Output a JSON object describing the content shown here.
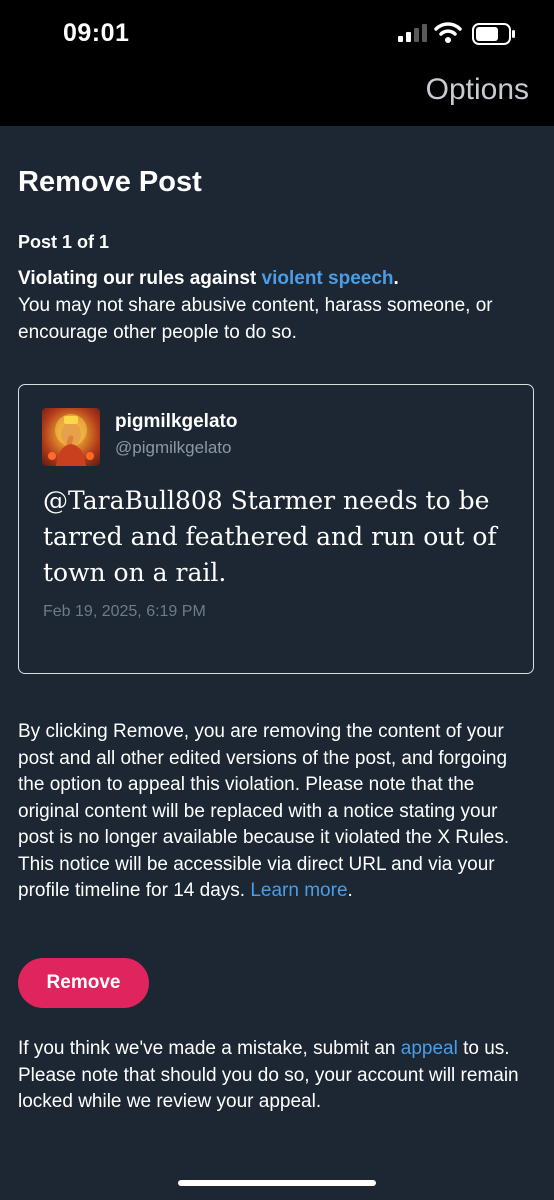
{
  "status_bar": {
    "time": "09:01"
  },
  "header": {
    "options_label": "Options"
  },
  "page": {
    "title": "Remove Post",
    "post_count": "Post 1 of 1",
    "violation_lead": "Violating our rules against ",
    "violation_link": "violent speech",
    "violation_period": ".",
    "violation_desc": "You may not share abusive content, harass someone, or encourage other people to do so."
  },
  "post": {
    "username": "pigmilkgelato",
    "handle": "@pigmilkgelato",
    "text": "@TaraBull808 Starmer needs to be tarred and feathered and run out of town on a rail.",
    "date": "Feb 19, 2025, 6:19 PM"
  },
  "disclaimer": {
    "text": "By clicking Remove, you are removing the content of your post and all other edited versions of the post, and forgoing the option to appeal this violation. Please note that the original content will be replaced with a notice stating your post is no longer available because it violated the X Rules. This notice will be accessible via direct URL and via your profile timeline for 14 days. ",
    "learn_more": "Learn more",
    "period": "."
  },
  "actions": {
    "remove_label": "Remove"
  },
  "appeal": {
    "text_before": "If you think we've made a mistake, submit an ",
    "link": "appeal",
    "text_after": " to us. Please note that should you do so, your account will remain locked while we review your appeal."
  },
  "colors": {
    "background": "#1c2733",
    "link": "#4a9de6",
    "remove_button": "#e0245e"
  }
}
